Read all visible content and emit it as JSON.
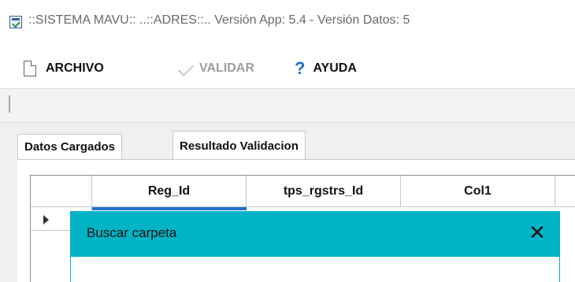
{
  "window": {
    "title": "::SISTEMA MAVU:: ..::ADRES::..  Versión App: 5.4  -  Versión Datos: 5",
    "icon": "app-window-icon"
  },
  "menu": {
    "items": [
      {
        "label": "ARCHIVO",
        "icon": "file-icon",
        "enabled": true
      },
      {
        "label": "VALIDAR",
        "icon": "check-icon",
        "enabled": false
      },
      {
        "label": "AYUDA",
        "icon": "help-icon",
        "enabled": true
      }
    ]
  },
  "tabs": [
    {
      "label": "Datos Cargados",
      "active": false
    },
    {
      "label": "Resultado Validacion",
      "active": true
    }
  ],
  "grid": {
    "columns": [
      "Reg_Id",
      "tps_rgstrs_Id",
      "Col1"
    ]
  },
  "dialog": {
    "title": "Buscar carpeta",
    "close_glyph": "✕"
  },
  "colors": {
    "dialog_titlebar": "#00b4c5",
    "selection": "#1f6fd1"
  }
}
